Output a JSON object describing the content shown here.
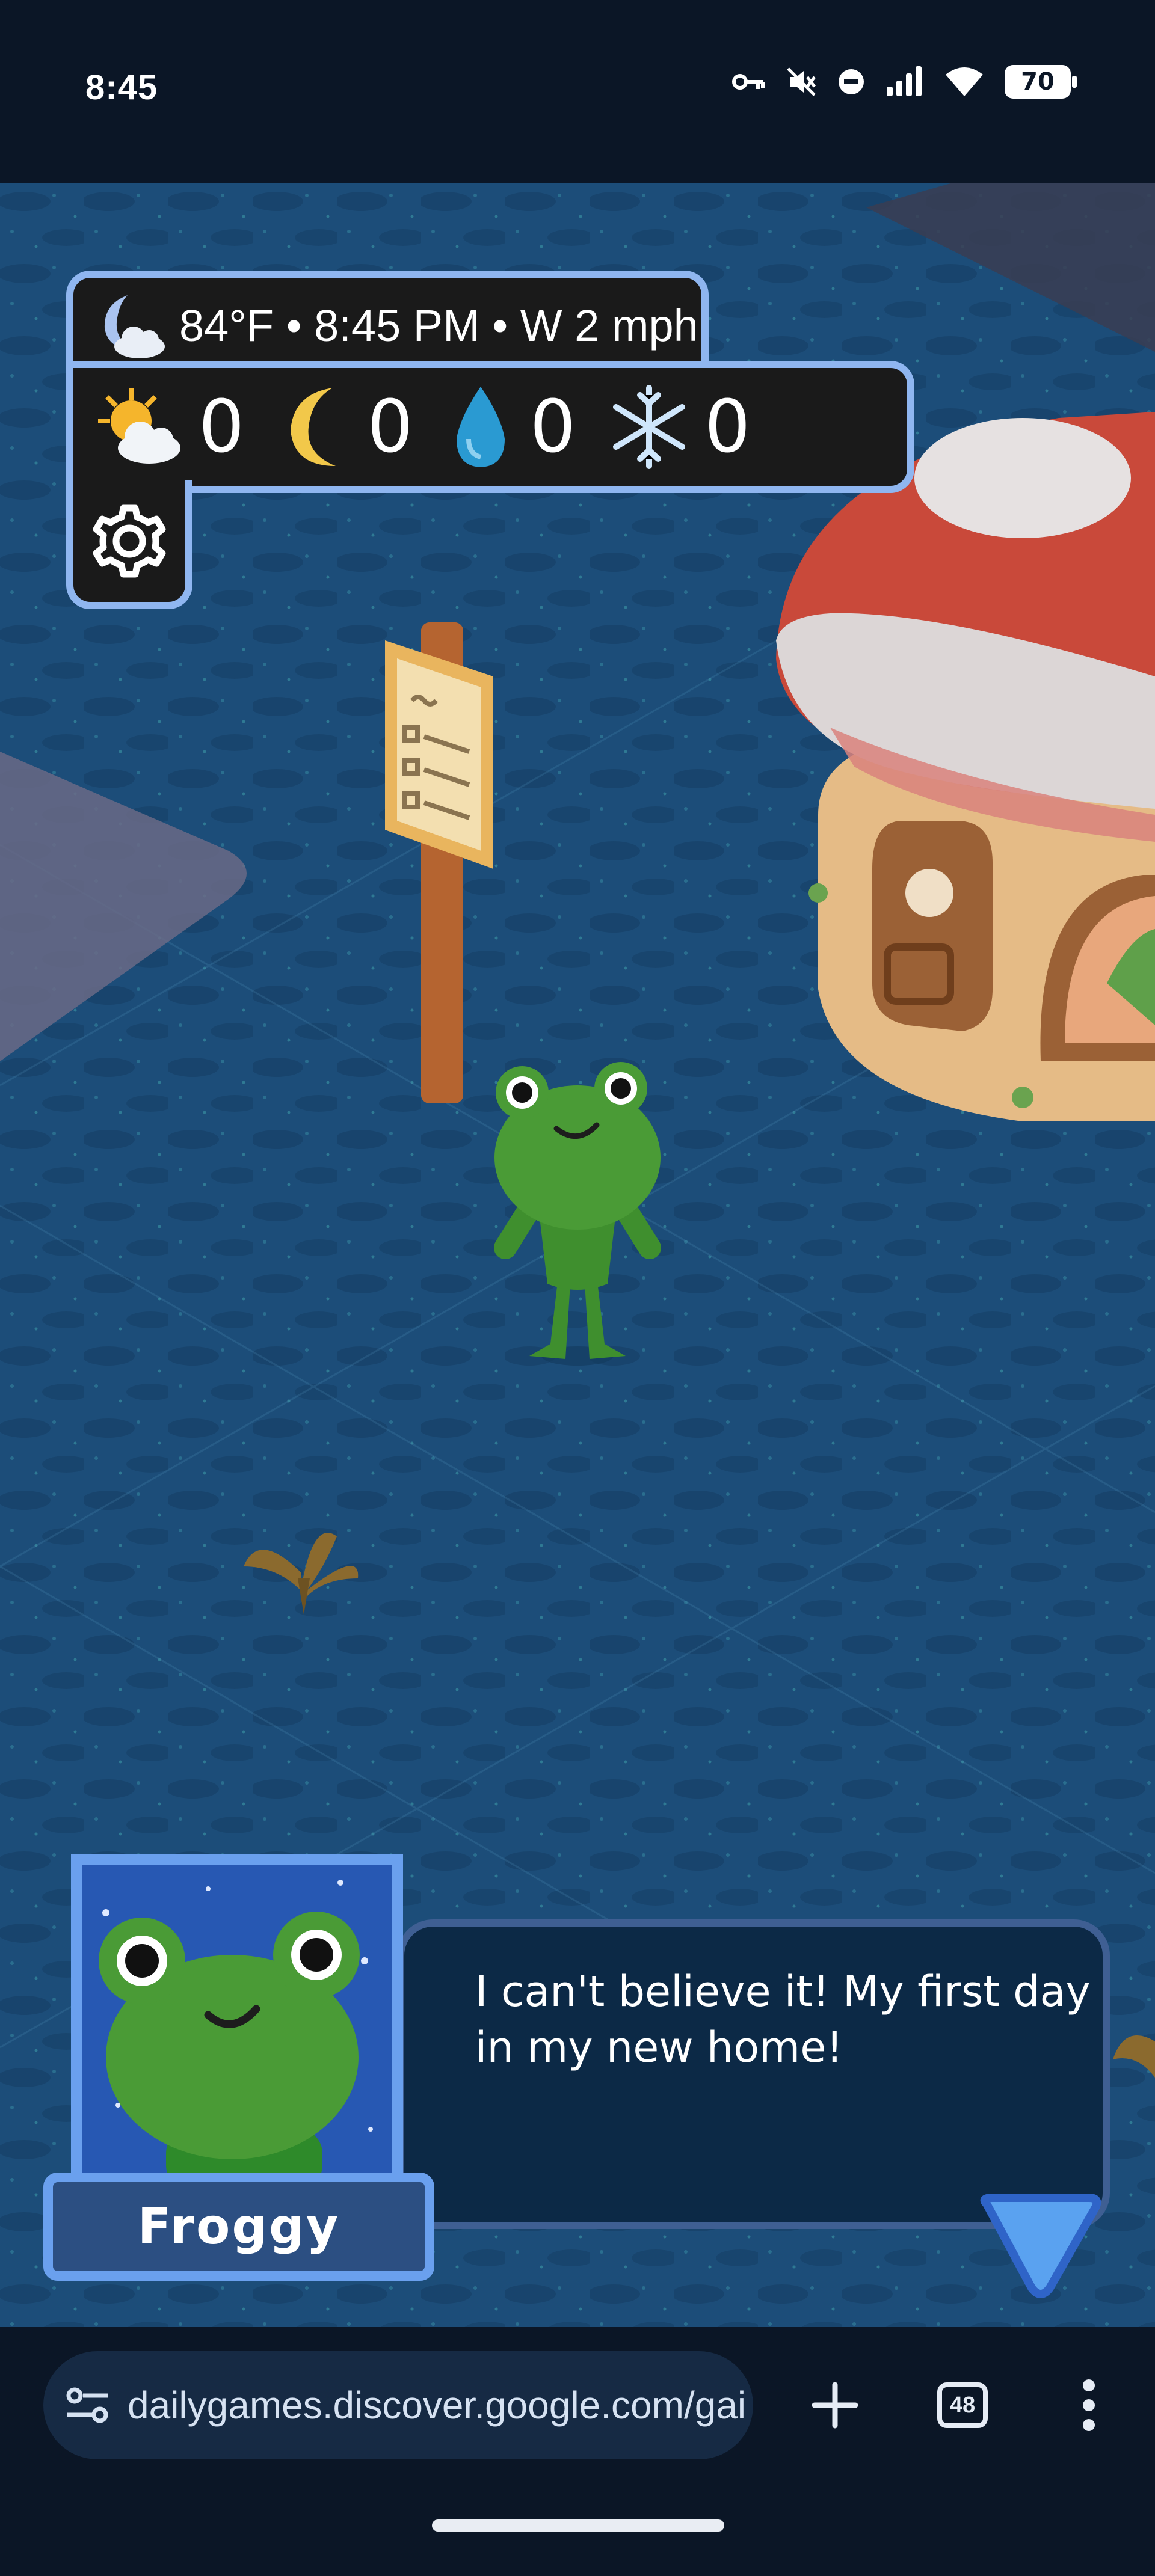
{
  "status_bar": {
    "time": "8:45",
    "battery_level": "70",
    "icons": [
      "vpn-key-icon",
      "mute-icon",
      "do-not-disturb-icon",
      "signal-icon",
      "wifi-icon",
      "battery-icon"
    ]
  },
  "hud": {
    "weather_icon": "moon-cloud-icon",
    "weather_text": "84°F • 8:45 PM • W 2 mph",
    "counters": [
      {
        "icon": "sun-cloud-icon",
        "value": "0"
      },
      {
        "icon": "moon-icon",
        "value": "0"
      },
      {
        "icon": "raindrop-icon",
        "value": "0"
      },
      {
        "icon": "snowflake-icon",
        "value": "0"
      }
    ],
    "settings_icon": "gear-icon"
  },
  "scene": {
    "objects": [
      "sign-board",
      "frog-character",
      "mushroom-house",
      "withered-plant",
      "stone-path"
    ]
  },
  "dialog": {
    "speaker": "Froggy",
    "text": "I can't believe it! My first day in my new home!",
    "next_icon": "triangle-down-icon"
  },
  "browser": {
    "url": "dailygames.discover.google.com/gai",
    "tab_count": "48",
    "site_info_icon": "tune-icon",
    "new_tab_icon": "plus-icon",
    "menu_icon": "more-vert-icon"
  },
  "colors": {
    "ground": "#1c4d79",
    "hud_border": "#8fb6f0",
    "dialog_bg": "#0c2946",
    "portrait_bg": "#2758b3",
    "frog_green": "#3f8f2e",
    "mushroom_red": "#c9493a"
  }
}
